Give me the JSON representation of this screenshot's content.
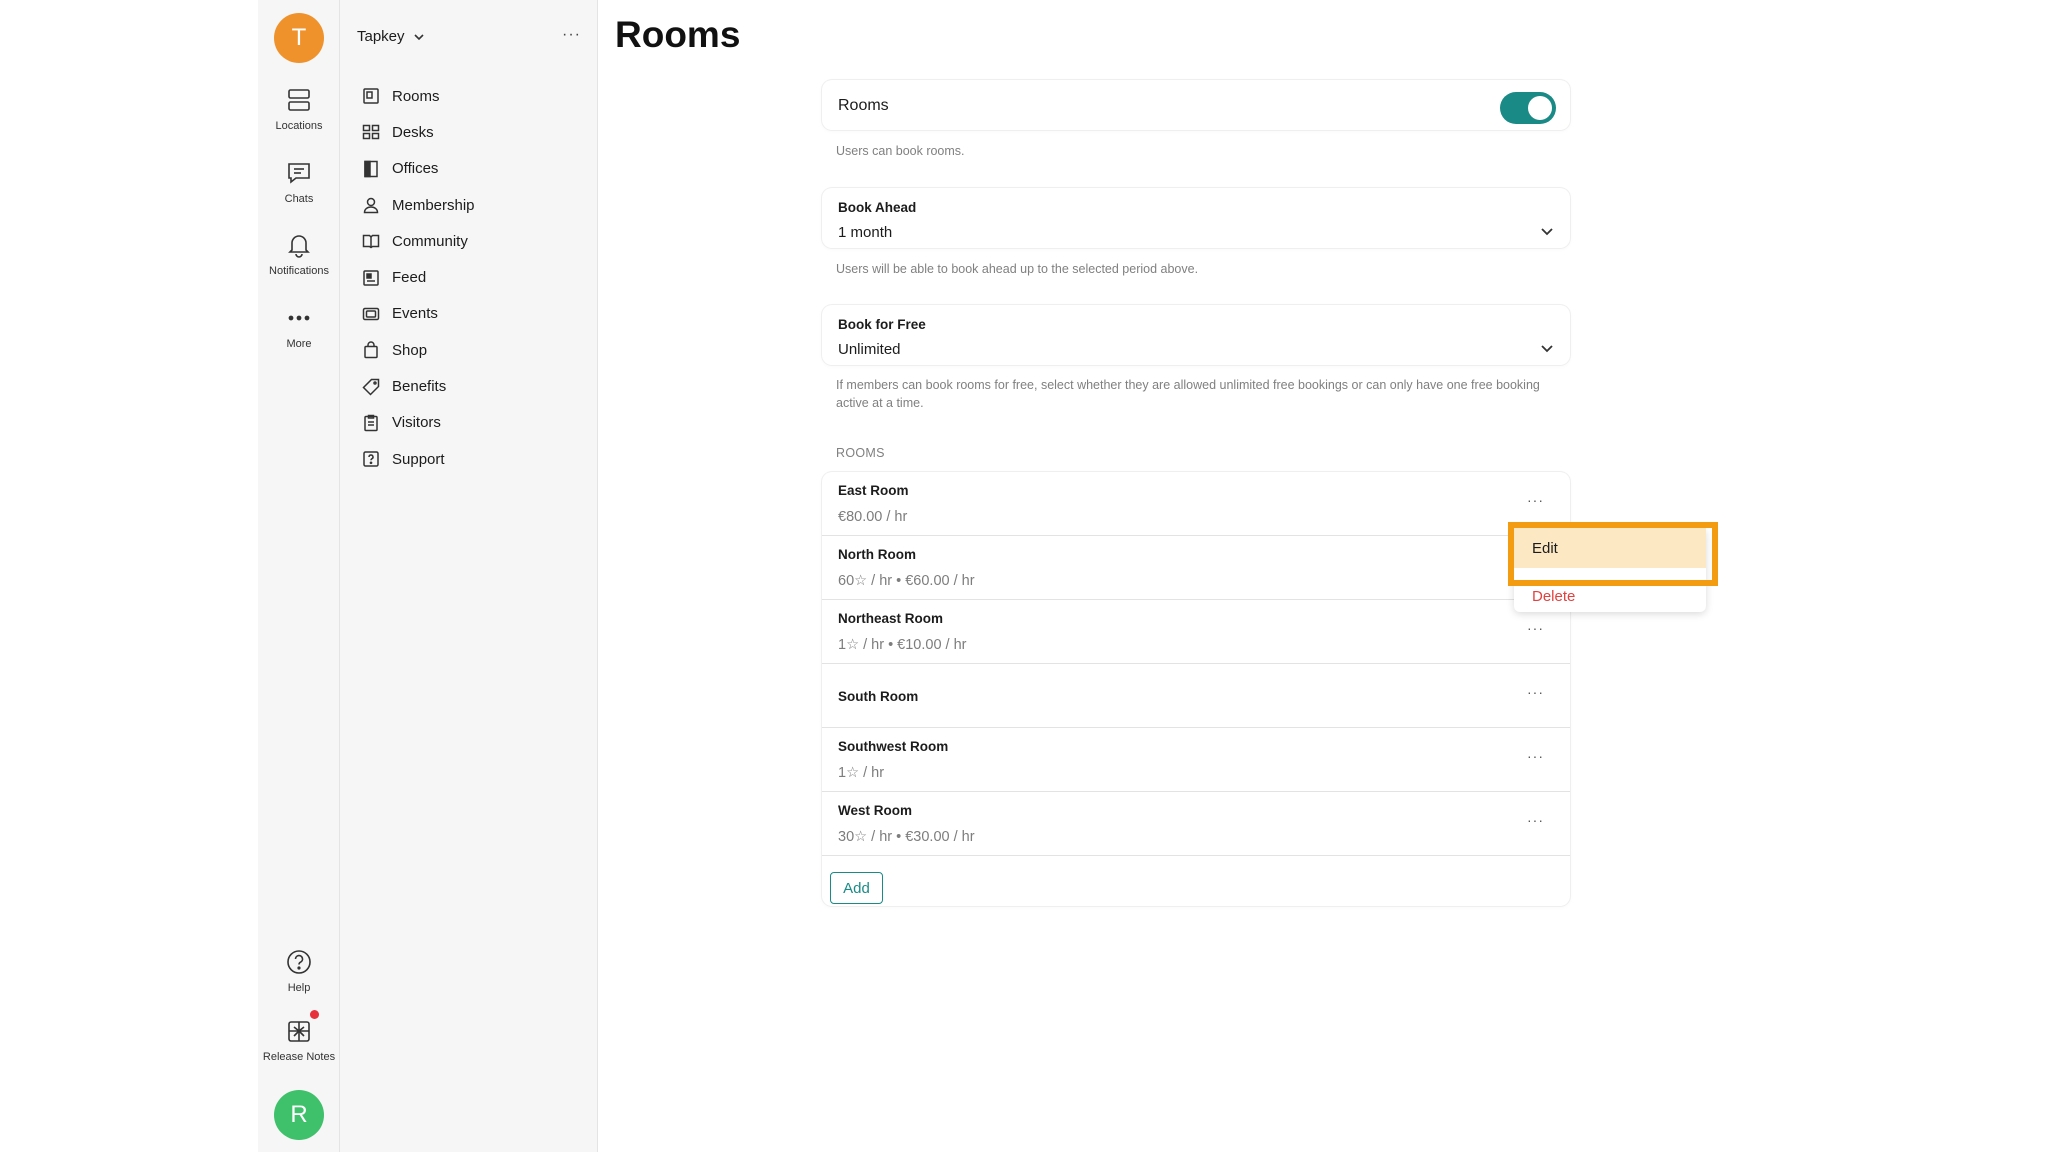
{
  "colors": {
    "accent": "#1a8a86",
    "avatar_top": "#f0922b",
    "avatar_bottom": "#3ec16a",
    "danger": "#e2413e",
    "highlight": "#f39c12"
  },
  "rail": {
    "avatar_initial": "T",
    "items": [
      {
        "label": "Locations",
        "icon": "locations-icon"
      },
      {
        "label": "Chats",
        "icon": "chat-icon"
      },
      {
        "label": "Notifications",
        "icon": "bell-icon"
      },
      {
        "label": "More",
        "icon": "more-icon"
      }
    ],
    "help_label": "Help",
    "release_notes_label": "Release Notes",
    "user_initial": "R"
  },
  "nav": {
    "workspace": "Tapkey",
    "items": [
      {
        "label": "Rooms",
        "icon": "rooms-icon"
      },
      {
        "label": "Desks",
        "icon": "desks-icon"
      },
      {
        "label": "Offices",
        "icon": "offices-icon"
      },
      {
        "label": "Membership",
        "icon": "person-icon"
      },
      {
        "label": "Community",
        "icon": "book-icon"
      },
      {
        "label": "Feed",
        "icon": "feed-icon"
      },
      {
        "label": "Events",
        "icon": "ticket-icon"
      },
      {
        "label": "Shop",
        "icon": "shopping-bag-icon"
      },
      {
        "label": "Benefits",
        "icon": "tag-icon"
      },
      {
        "label": "Visitors",
        "icon": "clipboard-icon"
      },
      {
        "label": "Support",
        "icon": "question-icon"
      }
    ]
  },
  "main": {
    "title": "Rooms",
    "rooms_toggle": {
      "label": "Rooms",
      "enabled": true,
      "helper": "Users can book rooms."
    },
    "book_ahead": {
      "label": "Book Ahead",
      "value": "1 month",
      "helper": "Users will be able to book ahead up to the selected period above."
    },
    "book_free": {
      "label": "Book for Free",
      "value": "Unlimited",
      "helper": "If members can book rooms for free, select whether they are allowed unlimited free bookings or can only have one free booking active at a time."
    },
    "rooms_section": "ROOMS",
    "rooms": [
      {
        "name": "East Room",
        "price": "€80.00 / hr"
      },
      {
        "name": "North Room",
        "price": "60☆ / hr • €60.00 / hr"
      },
      {
        "name": "Northeast Room",
        "price": "1☆ / hr • €10.00 / hr"
      },
      {
        "name": "South Room",
        "price": ""
      },
      {
        "name": "Southwest Room",
        "price": "1☆ / hr"
      },
      {
        "name": "West Room",
        "price": "30☆ / hr • €30.00 / hr"
      }
    ],
    "add_label": "Add",
    "menu": {
      "edit": "Edit",
      "delete": "Delete"
    }
  }
}
